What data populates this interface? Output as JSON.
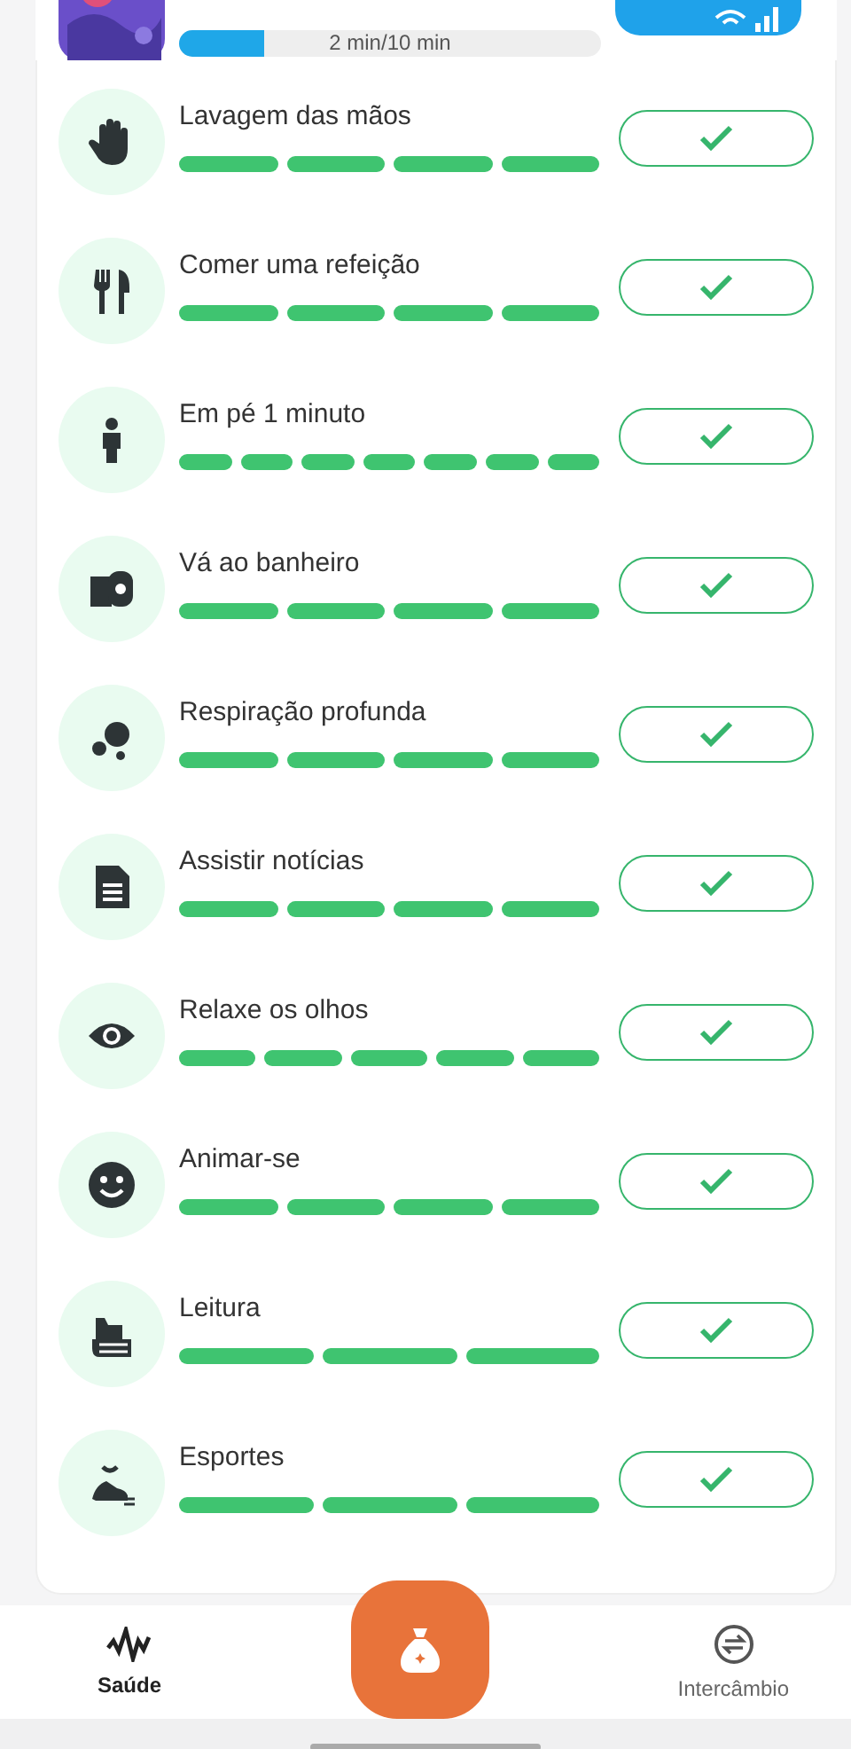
{
  "banner": {
    "progress_text": "2 min/10 min",
    "level": 0.2
  },
  "tasks": [
    {
      "kind": "hand",
      "title": "Lavagem das mãos",
      "steps": [
        {
          "done": true
        },
        {
          "done": true
        },
        {
          "done": true
        },
        {
          "done": true
        }
      ],
      "checked": true
    },
    {
      "kind": "cutlery",
      "title": "Comer uma refeição",
      "steps": [
        {
          "done": true
        },
        {
          "done": true
        },
        {
          "done": true
        },
        {
          "done": true
        }
      ],
      "checked": true
    },
    {
      "kind": "person",
      "title": "Em pé 1 minuto",
      "steps": [
        {
          "done": true
        },
        {
          "done": true
        },
        {
          "done": true
        },
        {
          "done": true
        },
        {
          "done": true
        },
        {
          "done": true
        },
        {
          "done": true
        }
      ],
      "checked": true
    },
    {
      "kind": "toilet-paper",
      "title": "Vá ao banheiro",
      "steps": [
        {
          "done": true
        },
        {
          "done": true
        },
        {
          "done": true
        },
        {
          "done": true
        }
      ],
      "checked": true
    },
    {
      "kind": "bubbles",
      "title": "Respiração profunda",
      "steps": [
        {
          "done": true
        },
        {
          "done": true
        },
        {
          "done": true
        },
        {
          "done": true
        }
      ],
      "checked": true
    },
    {
      "kind": "document",
      "title": "Assistir notícias",
      "steps": [
        {
          "done": true
        },
        {
          "done": true
        },
        {
          "done": true
        },
        {
          "done": true
        }
      ],
      "checked": true
    },
    {
      "kind": "eye",
      "title": "Relaxe os olhos",
      "steps": [
        {
          "done": true
        },
        {
          "done": true
        },
        {
          "done": true
        },
        {
          "done": true
        },
        {
          "done": true
        }
      ],
      "checked": true
    },
    {
      "kind": "smile",
      "title": "Animar-se",
      "steps": [
        {
          "done": true
        },
        {
          "done": true
        },
        {
          "done": true
        },
        {
          "done": true
        }
      ],
      "checked": true
    },
    {
      "kind": "book",
      "title": "Leitura",
      "steps": [
        {
          "done": true
        },
        {
          "done": true
        },
        {
          "done": true
        }
      ],
      "checked": true
    },
    {
      "kind": "shoe",
      "title": "Esportes",
      "steps": [
        {
          "done": true
        },
        {
          "done": true
        },
        {
          "done": true
        }
      ],
      "checked": true
    }
  ],
  "nav": [
    {
      "kind": "pulse",
      "label": "Saúde",
      "selected": true
    },
    {
      "kind": "bag"
    },
    {
      "kind": "exchange",
      "label": "Intercâmbio",
      "selected": false
    }
  ]
}
